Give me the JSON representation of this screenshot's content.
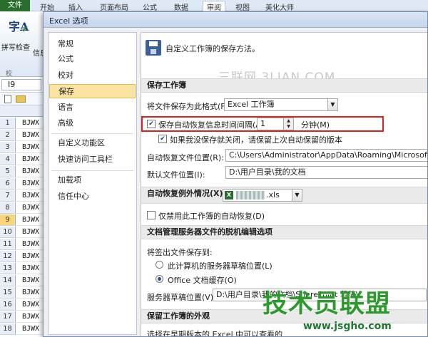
{
  "ribbon": {
    "tabs": [
      {
        "label": "文件"
      },
      {
        "label": "开始"
      },
      {
        "label": "插入"
      },
      {
        "label": "页面布局"
      },
      {
        "label": "公式"
      },
      {
        "label": "数据"
      },
      {
        "label": "审阅"
      },
      {
        "label": "视图"
      },
      {
        "label": "美化大师"
      }
    ],
    "spell_icon": "字A",
    "spell_label": "拼写检查",
    "info_label": "信息",
    "proof_label": "校"
  },
  "name_box": "I9",
  "grid": {
    "rows": [
      "1",
      "2",
      "3",
      "4",
      "5",
      "6",
      "7",
      "8",
      "9",
      "10",
      "11",
      "12",
      "13",
      "14",
      "15",
      "16",
      "17",
      "18"
    ],
    "cell_text": "BJWX",
    "selected_row": "9"
  },
  "dialog": {
    "title": "Excel 选项",
    "nav": [
      {
        "label": "常规"
      },
      {
        "label": "公式"
      },
      {
        "label": "校对"
      },
      {
        "label": "保存"
      },
      {
        "label": "语言"
      },
      {
        "label": "高级"
      },
      {
        "label": "自定义功能区"
      },
      {
        "label": "快速访问工具栏"
      },
      {
        "label": "加载项"
      },
      {
        "label": "信任中心"
      }
    ],
    "header_text": "自定义工作簿的保存方法。",
    "watermark": "三联网 3LIAN.COM",
    "save_section": {
      "title": "保存工作簿",
      "format_label": "将文件保存为此格式(F):",
      "format_value": "Excel 工作簿",
      "autorecover_label": "保存自动恢复信息时间间隔(A)",
      "autorecover_checked": true,
      "interval_value": "1",
      "interval_unit": "分钟(M)",
      "keep_last_label": "如果我没保存就关闭，请保留上次自动保留的版本",
      "keep_last_checked": true,
      "autorecover_location_label": "自动恢复文件位置(R):",
      "autorecover_location_value": "C:\\Users\\Administrator\\AppData\\Roaming\\Microsoft\\Excel\\",
      "default_location_label": "默认文件位置(I):",
      "default_location_value": "D:\\用户目录\\我的文档"
    },
    "exception_section": {
      "title": "自动恢复例外情况(X):",
      "file_suffix": ".xls",
      "disable_label": "仅禁用此工作簿的自动恢复(D)",
      "disable_checked": false
    },
    "offline_section": {
      "title": "文档管理服务器文件的脱机编辑选项",
      "checkout_label": "将签出文件保存到:",
      "option1_label": "此计算机的服务器草稿位置(L)",
      "option2_label": "Office 文档缓存(O)",
      "drafts_label": "服务器草稿位置(V):",
      "drafts_value": "D:\\用户目录\\我的文档\\SharePoint 草稿\\"
    },
    "appearance_section": {
      "title": "保留工作簿的外观",
      "desc": "选择在早期版本的 Excel 中可以查看的"
    }
  },
  "brand": {
    "logo": "技术员联盟",
    "url": "www.jsgho.com"
  }
}
